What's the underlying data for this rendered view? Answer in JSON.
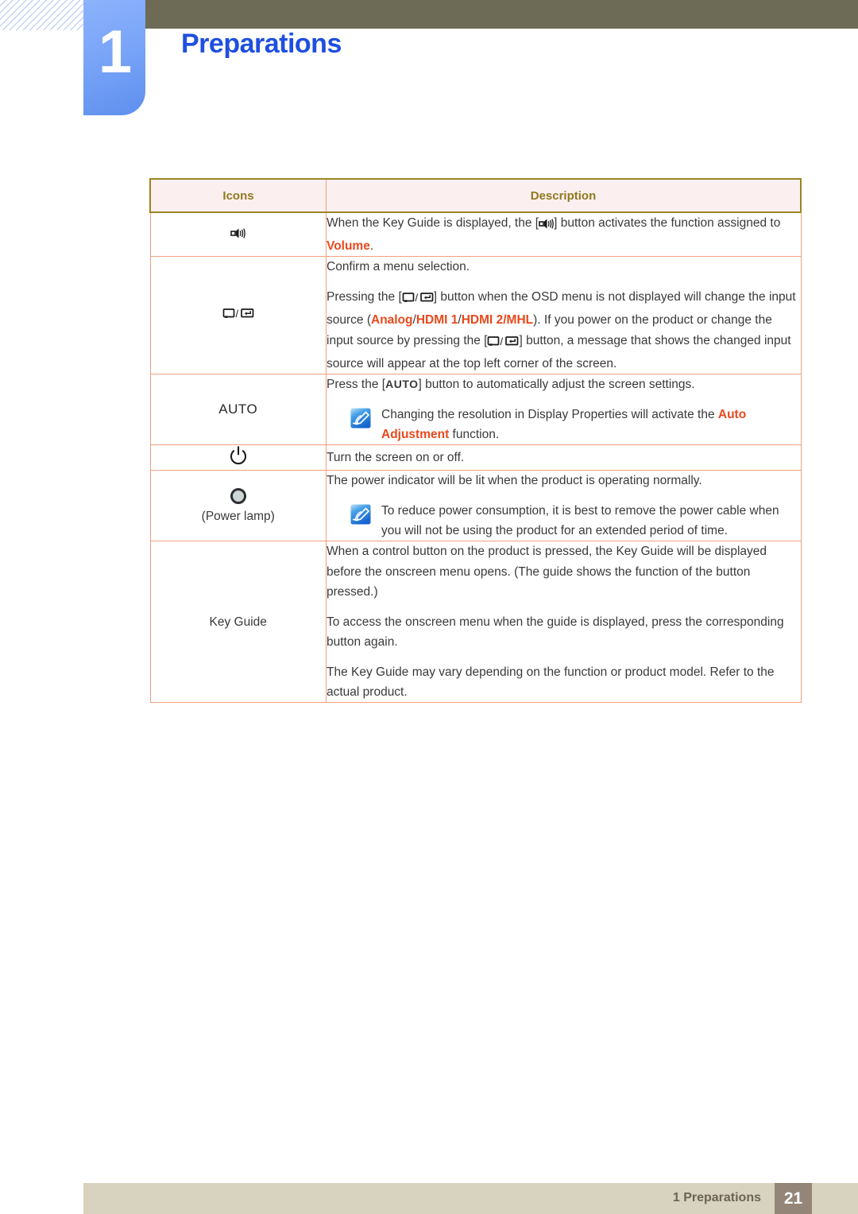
{
  "header": {
    "chapter_number": "1",
    "chapter_title": "Preparations"
  },
  "table": {
    "columns": [
      "Icons",
      "Description"
    ],
    "rows": [
      {
        "icon_name": "volume-speaker-icon",
        "icon_label": "",
        "paragraphs": [
          {
            "segments": [
              {
                "t": "When the Key Guide is displayed, the [",
                "s": "plain"
              },
              {
                "t": "speaker-icon",
                "s": "icon-speaker"
              },
              {
                "t": "] button activates the function assigned to ",
                "s": "plain"
              },
              {
                "t": "Volume",
                "s": "hl"
              },
              {
                "t": ".",
                "s": "plain"
              }
            ]
          }
        ]
      },
      {
        "icon_name": "source-enter-icon",
        "icon_label": "",
        "paragraphs": [
          {
            "segments": [
              {
                "t": "Confirm a menu selection.",
                "s": "plain"
              }
            ]
          },
          {
            "segments": [
              {
                "t": "Pressing the [",
                "s": "plain"
              },
              {
                "t": "source-enter-icon",
                "s": "icon-source-enter"
              },
              {
                "t": "] button when the OSD menu is not displayed will change the input source (",
                "s": "plain"
              },
              {
                "t": "Analog",
                "s": "hl"
              },
              {
                "t": "/",
                "s": "plain"
              },
              {
                "t": "HDMI 1",
                "s": "hl"
              },
              {
                "t": "/",
                "s": "plain"
              },
              {
                "t": "HDMI 2/MHL",
                "s": "hl"
              },
              {
                "t": "). If you power on the product or change the input source by pressing the [",
                "s": "plain"
              },
              {
                "t": "source-enter-icon",
                "s": "icon-source-enter"
              },
              {
                "t": "] button, a message that shows the changed input source will appear at the top left corner of the screen.",
                "s": "plain"
              }
            ]
          }
        ]
      },
      {
        "icon_name": "auto-button-icon",
        "icon_label": "AUTO",
        "paragraphs": [
          {
            "segments": [
              {
                "t": "Press the [",
                "s": "plain"
              },
              {
                "t": "AUTO",
                "s": "kbd"
              },
              {
                "t": "] button to automatically adjust the screen settings.",
                "s": "plain"
              }
            ]
          }
        ],
        "note": {
          "segments": [
            {
              "t": "Changing the resolution in Display Properties will activate the ",
              "s": "plain"
            },
            {
              "t": "Auto Adjustment",
              "s": "hl"
            },
            {
              "t": " function.",
              "s": "plain"
            }
          ]
        }
      },
      {
        "icon_name": "power-button-icon",
        "icon_label": "",
        "paragraphs": [
          {
            "segments": [
              {
                "t": "Turn the screen on or off.",
                "s": "plain"
              }
            ]
          }
        ]
      },
      {
        "icon_name": "power-lamp-icon",
        "icon_label": "(Power lamp)",
        "paragraphs": [
          {
            "segments": [
              {
                "t": "The power indicator will be lit when the product is operating normally.",
                "s": "plain"
              }
            ]
          }
        ],
        "note": {
          "segments": [
            {
              "t": "To reduce power consumption, it is best to remove the power cable when you will not be using the product for an extended period of time.",
              "s": "plain"
            }
          ]
        }
      },
      {
        "icon_name": "key-guide-label",
        "icon_label": "Key Guide",
        "paragraphs": [
          {
            "segments": [
              {
                "t": "When a control button on the product is pressed, the Key Guide will be displayed before the onscreen menu opens. (The guide shows the function of the button pressed.)",
                "s": "plain"
              }
            ]
          },
          {
            "segments": [
              {
                "t": "To access the onscreen menu when the guide is displayed, press the corresponding button again.",
                "s": "plain"
              }
            ]
          },
          {
            "segments": [
              {
                "t": "The Key Guide may vary depending on the function or product model. Refer to the actual product.",
                "s": "plain"
              }
            ]
          }
        ]
      }
    ]
  },
  "footer": {
    "label": "1 Preparations",
    "page_number": "21"
  },
  "colors": {
    "accent_blue": "#1f4fe0",
    "highlight_orange": "#e8491c",
    "table_border_gold": "#9c8424",
    "table_border_salmon": "#f0a080",
    "header_bg": "#fcefef",
    "top_bar": "#6d6b55",
    "footer_bg": "#d8d3bf",
    "page_box": "#938577"
  }
}
